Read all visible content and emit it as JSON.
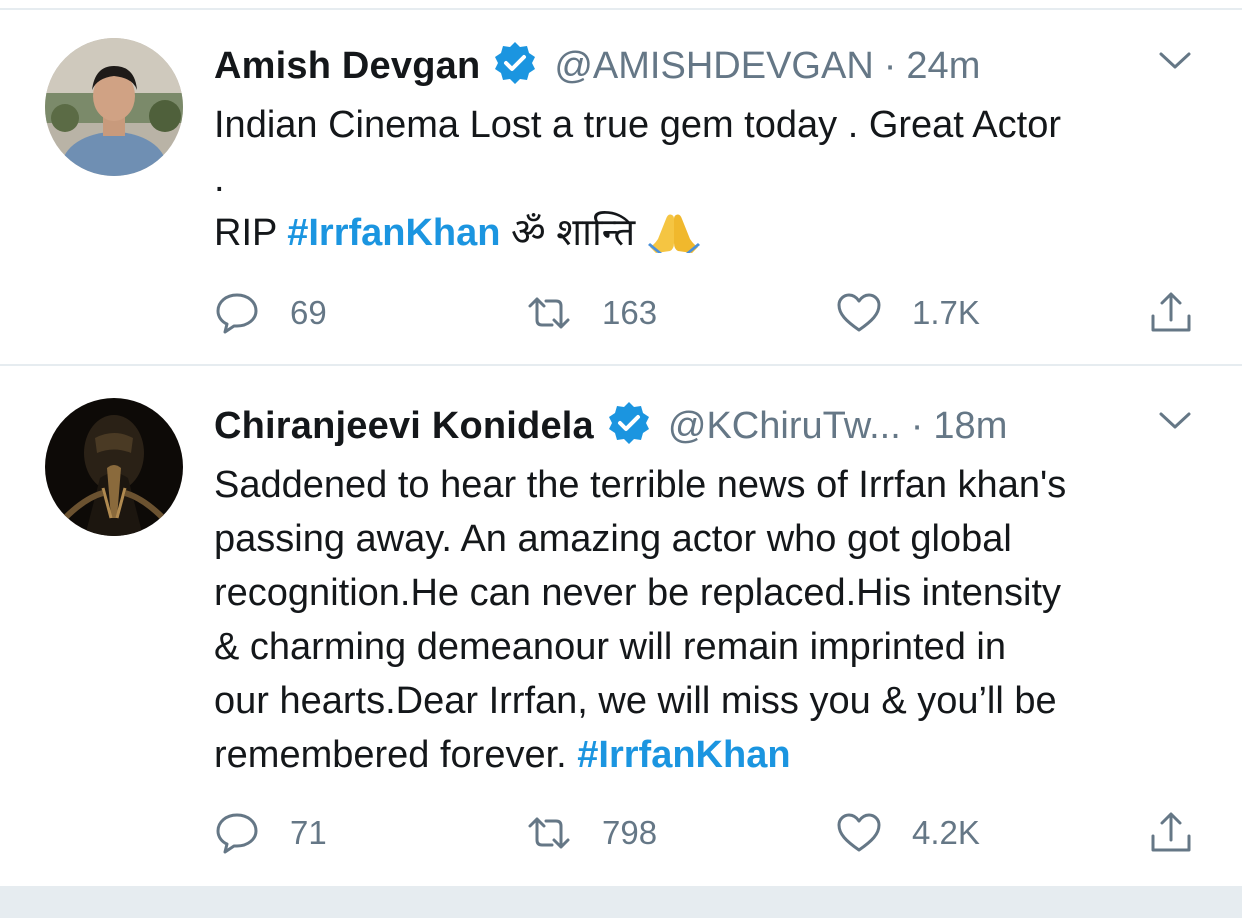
{
  "colors": {
    "accent": "#1b95e0",
    "text": "#14171a",
    "secondary": "#657786",
    "divider": "#e6ecf0"
  },
  "tweets": [
    {
      "name": "Amish Devgan",
      "handle": "@AMISHDEVGAN",
      "separator": "·",
      "time": "24m",
      "text_line1": "Indian Cinema Lost a true gem today . Great Actor",
      "text_line2": ".",
      "text_line3_prefix": "RIP ",
      "hashtag": "#IrrfanKhan",
      "text_line3_suffix": " ॐ शान्ति ",
      "emoji_icon": "folded-hands-icon",
      "replies": "69",
      "retweets": "163",
      "likes": "1.7K"
    },
    {
      "name": "Chiranjeevi Konidela",
      "handle": "@KChiruTw...",
      "separator": "·",
      "time": "18m",
      "text": "Saddened to hear the terrible news of Irrfan khan's\npassing away. An amazing actor who got global\nrecognition.He can never be replaced.His intensity\n& charming demeanour will remain imprinted in\nour hearts.Dear Irrfan, we will miss you & you’ll be\nremembered forever. ",
      "hashtag": "#IrrfanKhan",
      "replies": "71",
      "retweets": "798",
      "likes": "4.2K"
    }
  ],
  "icons": {
    "verified": "verified-badge-icon",
    "chevron": "chevron-down-icon",
    "reply": "reply-icon",
    "retweet": "retweet-icon",
    "like": "heart-icon",
    "share": "share-icon"
  }
}
